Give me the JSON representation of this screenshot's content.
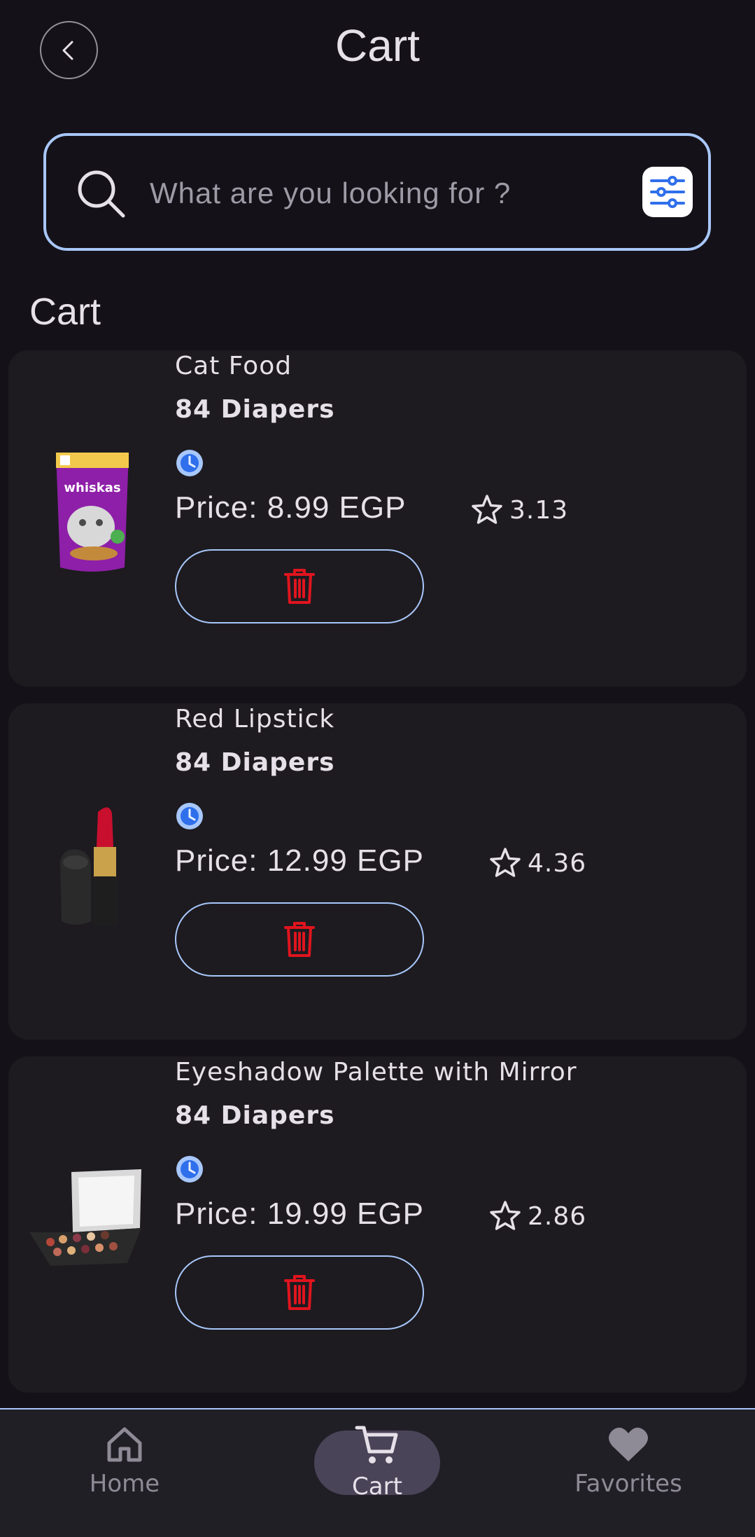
{
  "header": {
    "title": "Cart"
  },
  "search": {
    "placeholder": "What are you looking for ?",
    "value": ""
  },
  "section": {
    "title": "Cart"
  },
  "colors": {
    "accent": "#A8C7FA",
    "delete": "#E0141E",
    "background": "#141218",
    "card": "#1D1B20"
  },
  "cart_items": [
    {
      "name": "Cat Food",
      "subtitle": "84 Diapers",
      "price": "Price: 8.99 EGP",
      "rating": "3.13",
      "image_icon": "cat-food-pouch-icon"
    },
    {
      "name": "Red Lipstick",
      "subtitle": "84 Diapers",
      "price": "Price: 12.99 EGP",
      "rating": "4.36",
      "image_icon": "lipstick-icon"
    },
    {
      "name": "Eyeshadow Palette with Mirror",
      "subtitle": "84 Diapers",
      "price": "Price: 19.99 EGP",
      "rating": "2.86",
      "image_icon": "eyeshadow-palette-icon"
    }
  ],
  "nav": {
    "items": [
      {
        "label": "Home",
        "icon": "home-icon",
        "active": false
      },
      {
        "label": "Cart",
        "icon": "cart-icon",
        "active": true
      },
      {
        "label": "Favorites",
        "icon": "heart-icon",
        "active": false
      }
    ]
  }
}
